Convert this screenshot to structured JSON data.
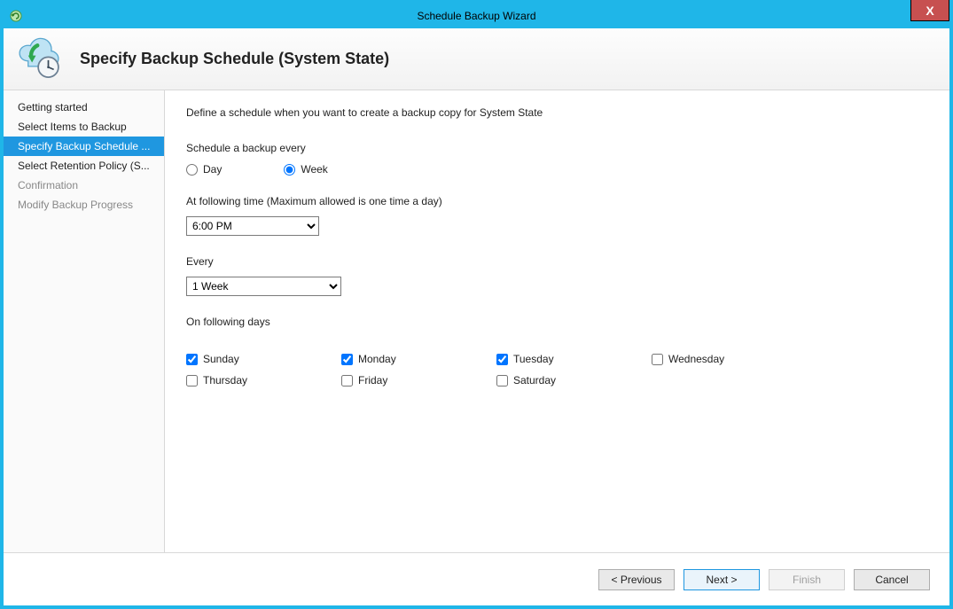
{
  "window": {
    "title": "Schedule Backup Wizard",
    "close_icon": "X"
  },
  "header": {
    "title": "Specify Backup Schedule (System State)"
  },
  "sidebar": {
    "items": [
      {
        "label": "Getting started",
        "state": "normal"
      },
      {
        "label": "Select Items to Backup",
        "state": "normal"
      },
      {
        "label": "Specify Backup Schedule ...",
        "state": "selected"
      },
      {
        "label": "Select Retention Policy (S...",
        "state": "normal"
      },
      {
        "label": "Confirmation",
        "state": "disabled"
      },
      {
        "label": "Modify Backup Progress",
        "state": "disabled"
      }
    ]
  },
  "content": {
    "instruction": "Define a schedule when you want to create a backup copy for System State",
    "frequency_label": "Schedule a backup every",
    "frequency_options": {
      "day": "Day",
      "week": "Week"
    },
    "frequency_selected": "Week",
    "time_label": "At following time (Maximum allowed is one time a day)",
    "time_value": "6:00 PM",
    "every_label": "Every",
    "every_value": "1 Week",
    "days_label": "On following days",
    "days": [
      {
        "name": "Sunday",
        "checked": true
      },
      {
        "name": "Monday",
        "checked": true
      },
      {
        "name": "Tuesday",
        "checked": true
      },
      {
        "name": "Wednesday",
        "checked": false
      },
      {
        "name": "Thursday",
        "checked": false
      },
      {
        "name": "Friday",
        "checked": false
      },
      {
        "name": "Saturday",
        "checked": false
      }
    ]
  },
  "footer": {
    "previous": "< Previous",
    "next": "Next >",
    "finish": "Finish",
    "cancel": "Cancel"
  }
}
